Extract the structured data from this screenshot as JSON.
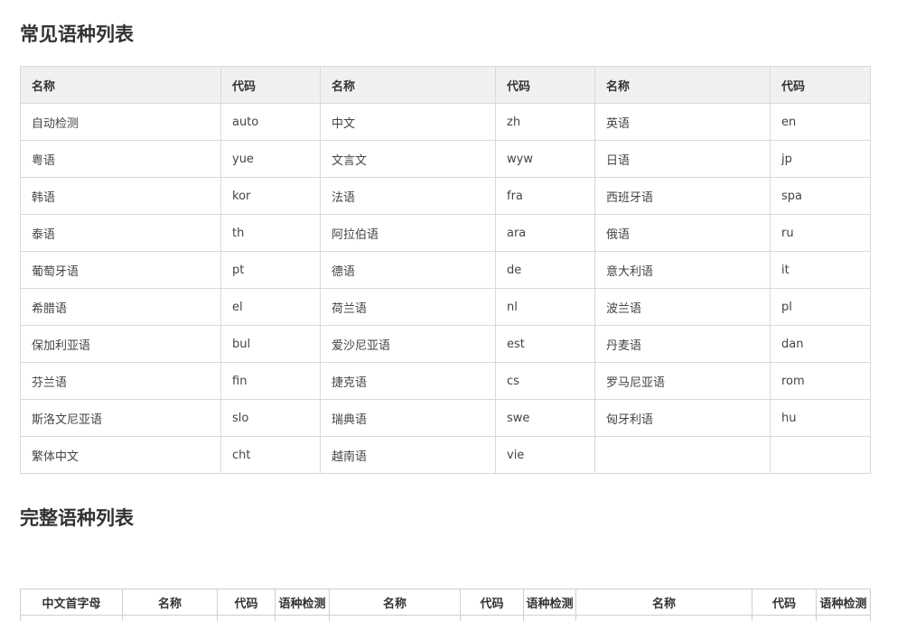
{
  "sections": {
    "common_title": "常见语种列表",
    "full_title": "完整语种列表"
  },
  "common_table": {
    "headers": [
      "名称",
      "代码",
      "名称",
      "代码",
      "名称",
      "代码"
    ],
    "rows": [
      [
        "自动检测",
        "auto",
        "中文",
        "zh",
        "英语",
        "en"
      ],
      [
        "粤语",
        "yue",
        "文言文",
        "wyw",
        "日语",
        "jp"
      ],
      [
        "韩语",
        "kor",
        "法语",
        "fra",
        "西班牙语",
        "spa"
      ],
      [
        "泰语",
        "th",
        "阿拉伯语",
        "ara",
        "俄语",
        "ru"
      ],
      [
        "葡萄牙语",
        "pt",
        "德语",
        "de",
        "意大利语",
        "it"
      ],
      [
        "希腊语",
        "el",
        "荷兰语",
        "nl",
        "波兰语",
        "pl"
      ],
      [
        "保加利亚语",
        "bul",
        "爱沙尼亚语",
        "est",
        "丹麦语",
        "dan"
      ],
      [
        "芬兰语",
        "fin",
        "捷克语",
        "cs",
        "罗马尼亚语",
        "rom"
      ],
      [
        "斯洛文尼亚语",
        "slo",
        "瑞典语",
        "swe",
        "匈牙利语",
        "hu"
      ],
      [
        "繁体中文",
        "cht",
        "越南语",
        "vie",
        "",
        ""
      ]
    ]
  },
  "full_table": {
    "headers": [
      "中文首字母",
      "名称",
      "代码",
      "语种检测",
      "名称",
      "代码",
      "语种检测",
      "名称",
      "代码",
      "语种检测"
    ]
  }
}
